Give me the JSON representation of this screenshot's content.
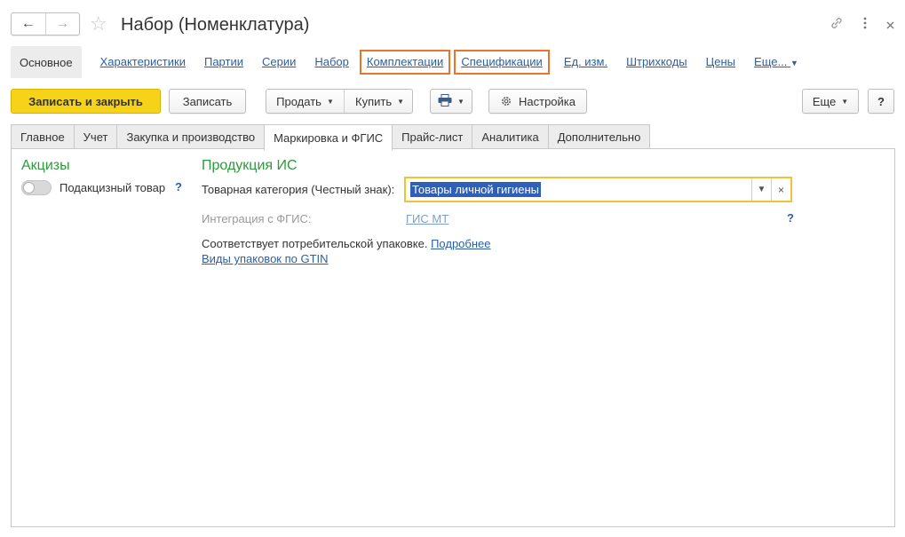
{
  "window": {
    "title": "Набор (Номенклатура)",
    "back_icon": "←",
    "forward_icon": "→"
  },
  "linkbar": {
    "current": "Основное",
    "items": [
      "Характеристики",
      "Партии",
      "Серии",
      "Набор",
      "Комплектации",
      "Спецификации",
      "Ед. изм.",
      "Штрихкоды",
      "Цены",
      "Еще..."
    ],
    "highlight_color": "#e8752a"
  },
  "commands": {
    "save_close": "Записать и закрыть",
    "save": "Записать",
    "sell": "Продать",
    "buy": "Купить",
    "settings": "Настройка",
    "more": "Еще",
    "help": "?"
  },
  "tabs": [
    "Главное",
    "Учет",
    "Закупка и производство",
    "Маркировка и ФГИС",
    "Прайс-лист",
    "Аналитика",
    "Дополнительно"
  ],
  "active_tab": "Маркировка и ФГИС",
  "excise": {
    "title": "Акцизы",
    "toggle_label": "Подакцизный товар",
    "toggle_on": false,
    "help": "?"
  },
  "product_is": {
    "title": "Продукция ИС",
    "category_label": "Товарная категория (Честный знак):",
    "category_value": "Товары личной гигиены",
    "integration_label": "Интеграция с ФГИС:",
    "integration_value": "ГИС МТ",
    "integration_help": "?",
    "packaging_text": "Соответствует потребительской упаковке.",
    "packaging_more": "Подробнее",
    "gtin_link": "Виды упаковок по GTIN"
  },
  "colors": {
    "primary_button": "#f6d318",
    "section_title": "#2f9a3c",
    "link": "#2a5fa8",
    "field_focus": "#f1c232",
    "selection": "#2f5fb7"
  }
}
